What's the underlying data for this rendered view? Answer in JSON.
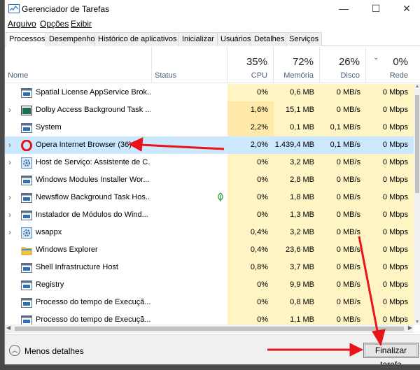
{
  "window": {
    "title": "Gerenciador de Tarefas",
    "minimize": "—",
    "maximize": "☐",
    "close": "✕"
  },
  "menu": [
    "Arquivo",
    "Opções",
    "Exibir"
  ],
  "tabs": [
    "Processos",
    "Desempenho",
    "Histórico de aplicativos",
    "Inicializar",
    "Usuários",
    "Detalhes",
    "Serviços"
  ],
  "columns": {
    "name": "Nome",
    "status": "Status",
    "cpu": {
      "pct": "35%",
      "label": "CPU"
    },
    "memory": {
      "pct": "72%",
      "label": "Memória"
    },
    "disk": {
      "pct": "26%",
      "label": "Disco"
    },
    "network": {
      "pct": "0%",
      "label": "Rede"
    }
  },
  "processes": [
    {
      "name": "Spatial License AppService Brok...",
      "cpu": "0%",
      "mem": "0,6 MB",
      "disk": "0 MB/s",
      "net": "0 Mbps",
      "expand": false,
      "icon": "service-window-icon"
    },
    {
      "name": "Dolby Access Background Task ...",
      "cpu": "1,6%",
      "mem": "15,1 MB",
      "disk": "0 MB/s",
      "net": "0 Mbps",
      "expand": true,
      "icon": "app-window-icon"
    },
    {
      "name": "System",
      "cpu": "2,2%",
      "mem": "0,1 MB",
      "disk": "0,1 MB/s",
      "net": "0 Mbps",
      "expand": false,
      "icon": "service-window-icon"
    },
    {
      "name": "Opera Internet Browser (36)",
      "cpu": "2,0%",
      "mem": "1.439,4 MB",
      "disk": "0,1 MB/s",
      "net": "0 Mbps",
      "expand": true,
      "icon": "opera-icon"
    },
    {
      "name": "Host de Serviço: Assistente de C...",
      "cpu": "0%",
      "mem": "3,2 MB",
      "disk": "0 MB/s",
      "net": "0 Mbps",
      "expand": true,
      "icon": "gear-icon"
    },
    {
      "name": "Windows Modules Installer Wor...",
      "cpu": "0%",
      "mem": "2,8 MB",
      "disk": "0 MB/s",
      "net": "0 Mbps",
      "expand": false,
      "icon": "service-window-icon"
    },
    {
      "name": "Newsflow Background Task Hos...",
      "cpu": "0%",
      "mem": "1,8 MB",
      "disk": "0 MB/s",
      "net": "0 Mbps",
      "expand": true,
      "icon": "service-window-icon"
    },
    {
      "name": "Instalador de Módulos do Wind...",
      "cpu": "0%",
      "mem": "1,3 MB",
      "disk": "0 MB/s",
      "net": "0 Mbps",
      "expand": true,
      "icon": "service-window-icon"
    },
    {
      "name": "wsappx",
      "cpu": "0,4%",
      "mem": "3,2 MB",
      "disk": "0 MB/s",
      "net": "0 Mbps",
      "expand": true,
      "icon": "gear-icon"
    },
    {
      "name": "Windows Explorer",
      "cpu": "0,4%",
      "mem": "23,6 MB",
      "disk": "0 MB/s",
      "net": "0 Mbps",
      "expand": false,
      "icon": "folder-icon"
    },
    {
      "name": "Shell Infrastructure Host",
      "cpu": "0,8%",
      "mem": "3,7 MB",
      "disk": "0 MB/s",
      "net": "0 Mbps",
      "expand": false,
      "icon": "service-window-icon"
    },
    {
      "name": "Registry",
      "cpu": "0%",
      "mem": "9,9 MB",
      "disk": "0 MB/s",
      "net": "0 Mbps",
      "expand": false,
      "icon": "service-window-icon"
    },
    {
      "name": "Processo do tempo de Execuçã...",
      "cpu": "0%",
      "mem": "0,8 MB",
      "disk": "0 MB/s",
      "net": "0 Mbps",
      "expand": false,
      "icon": "service-window-icon"
    },
    {
      "name": "Processo do tempo de Execuçã...",
      "cpu": "0%",
      "mem": "1,1 MB",
      "disk": "0 MB/s",
      "net": "0 Mbps",
      "expand": false,
      "icon": "service-window-icon"
    }
  ],
  "footer": {
    "less_details": "Menos detalhes",
    "end_task": "Finalizar tarefa"
  },
  "colors": {
    "cpu_heat_light": "#fff4c4",
    "cpu_heat_mid": "#ffe8a0",
    "selection": "#cce8ff",
    "annotation_arrow": "#e8141a"
  }
}
